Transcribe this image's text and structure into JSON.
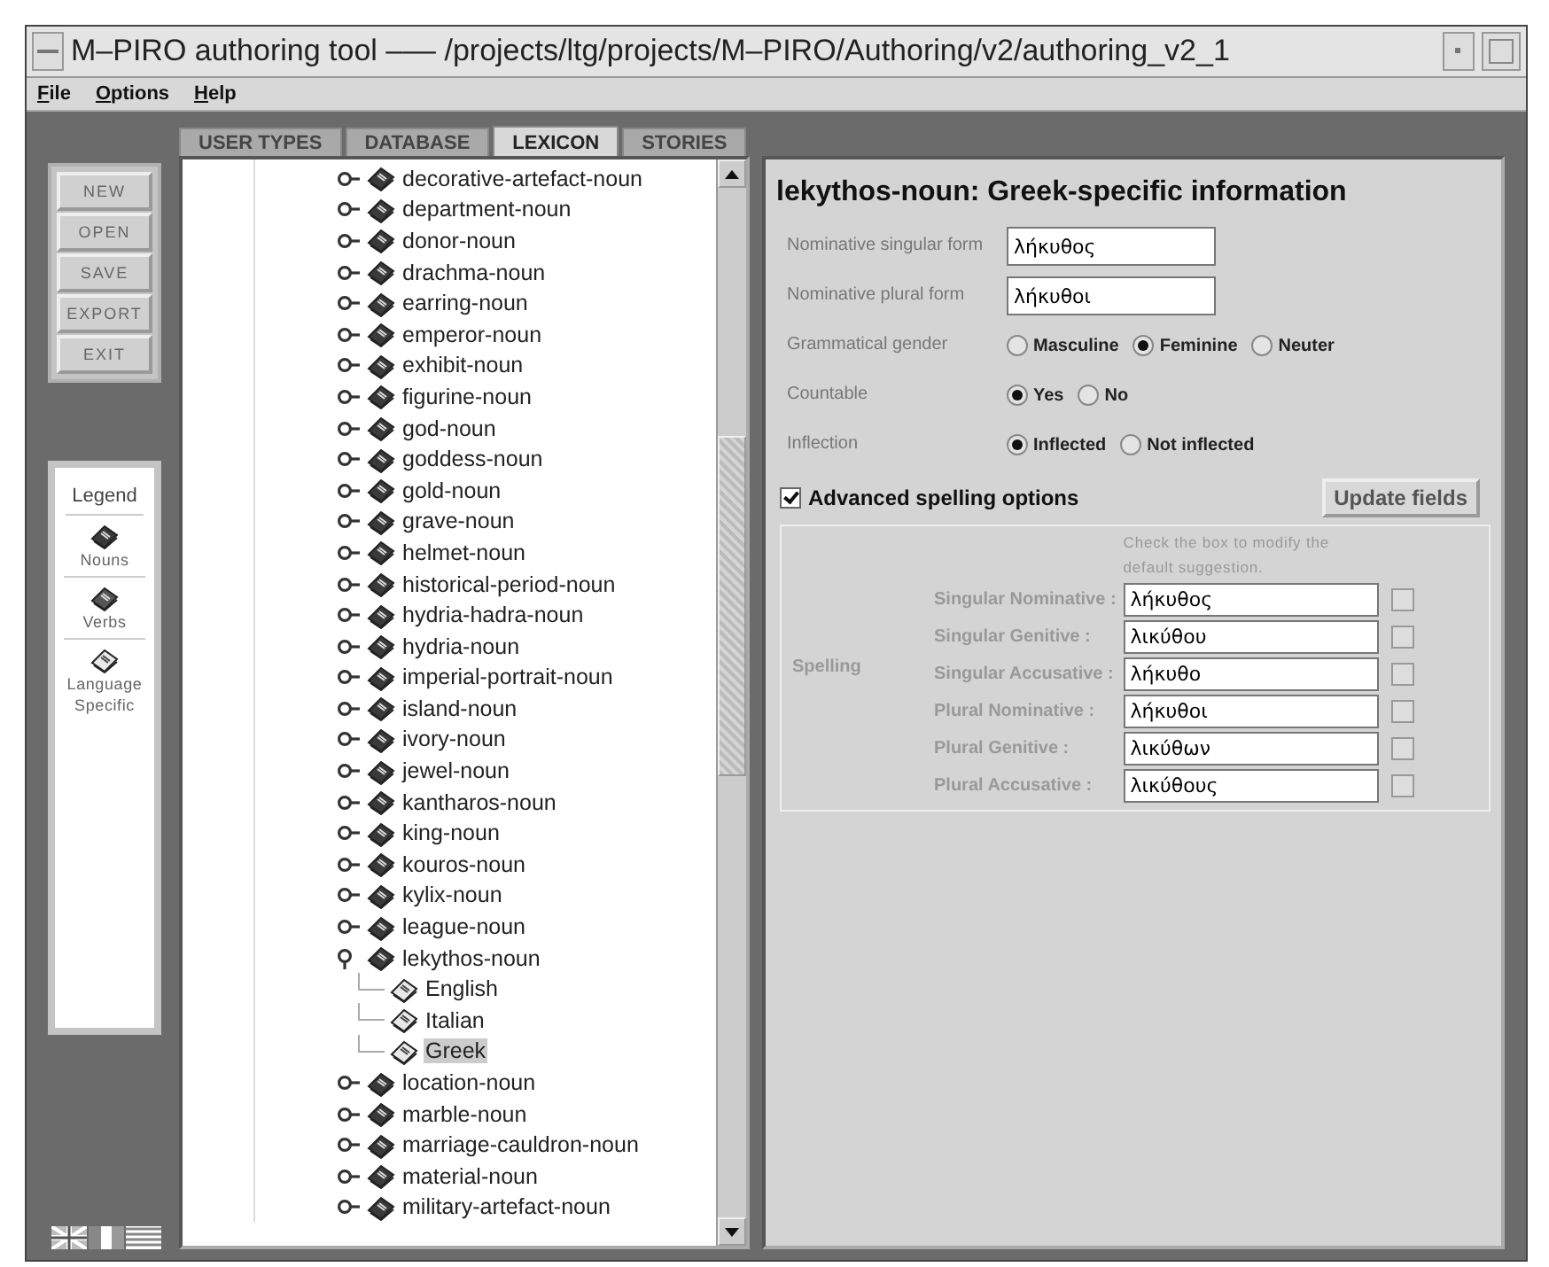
{
  "window": {
    "title": "M–PIRO authoring tool ––– /projects/ltg/projects/M–PIRO/Authoring/v2/authoring_v2_1"
  },
  "menu": [
    "File",
    "Options",
    "Help"
  ],
  "tabs": [
    {
      "label": "USER TYPES",
      "selected": false
    },
    {
      "label": "DATABASE",
      "selected": false
    },
    {
      "label": "LEXICON",
      "selected": true
    },
    {
      "label": "STORIES",
      "selected": false
    }
  ],
  "sidebar": {
    "buttons": [
      "NEW",
      "OPEN",
      "SAVE",
      "EXPORT",
      "EXIT"
    ],
    "legend": {
      "title": "Legend",
      "items": [
        {
          "kind": "noun",
          "label": "Nouns"
        },
        {
          "kind": "verb",
          "label": "Verbs"
        },
        {
          "kind": "language",
          "label": "Language Specific"
        }
      ]
    }
  },
  "tree": {
    "items": [
      {
        "label": "decorative-artefact-noun",
        "expanded": false,
        "selected": false
      },
      {
        "label": "department-noun",
        "expanded": false,
        "selected": false
      },
      {
        "label": "donor-noun",
        "expanded": false,
        "selected": false
      },
      {
        "label": "drachma-noun",
        "expanded": false,
        "selected": false
      },
      {
        "label": "earring-noun",
        "expanded": false,
        "selected": false
      },
      {
        "label": "emperor-noun",
        "expanded": false,
        "selected": false
      },
      {
        "label": "exhibit-noun",
        "expanded": false,
        "selected": false
      },
      {
        "label": "figurine-noun",
        "expanded": false,
        "selected": false
      },
      {
        "label": "god-noun",
        "expanded": false,
        "selected": false
      },
      {
        "label": "goddess-noun",
        "expanded": false,
        "selected": false
      },
      {
        "label": "gold-noun",
        "expanded": false,
        "selected": false
      },
      {
        "label": "grave-noun",
        "expanded": false,
        "selected": false
      },
      {
        "label": "helmet-noun",
        "expanded": false,
        "selected": false
      },
      {
        "label": "historical-period-noun",
        "expanded": false,
        "selected": false
      },
      {
        "label": "hydria-hadra-noun",
        "expanded": false,
        "selected": false
      },
      {
        "label": "hydria-noun",
        "expanded": false,
        "selected": false
      },
      {
        "label": "imperial-portrait-noun",
        "expanded": false,
        "selected": false
      },
      {
        "label": "island-noun",
        "expanded": false,
        "selected": false
      },
      {
        "label": "ivory-noun",
        "expanded": false,
        "selected": false
      },
      {
        "label": "jewel-noun",
        "expanded": false,
        "selected": false
      },
      {
        "label": "kantharos-noun",
        "expanded": false,
        "selected": false
      },
      {
        "label": "king-noun",
        "expanded": false,
        "selected": false
      },
      {
        "label": "kouros-noun",
        "expanded": false,
        "selected": false
      },
      {
        "label": "kylix-noun",
        "expanded": false,
        "selected": false
      },
      {
        "label": "league-noun",
        "expanded": false,
        "selected": false
      },
      {
        "label": "lekythos-noun",
        "expanded": true,
        "selected": false,
        "children": [
          {
            "label": "English",
            "selected": false
          },
          {
            "label": "Italian",
            "selected": false
          },
          {
            "label": "Greek",
            "selected": true
          }
        ]
      },
      {
        "label": "location-noun",
        "expanded": false,
        "selected": false
      },
      {
        "label": "marble-noun",
        "expanded": false,
        "selected": false
      },
      {
        "label": "marriage-cauldron-noun",
        "expanded": false,
        "selected": false
      },
      {
        "label": "material-noun",
        "expanded": false,
        "selected": false
      },
      {
        "label": "military-artefact-noun",
        "expanded": false,
        "selected": false
      }
    ]
  },
  "detail": {
    "heading": "lekythos-noun: Greek-specific information",
    "fields": [
      {
        "label": "Nominative singular form",
        "value": "λήκυθος"
      },
      {
        "label": "Nominative plural form",
        "value": "λήκυθοι"
      }
    ],
    "radio_groups": [
      {
        "label": "Grammatical gender",
        "options": [
          {
            "label": "Masculine",
            "selected": false
          },
          {
            "label": "Feminine",
            "selected": true
          },
          {
            "label": "Neuter",
            "selected": false
          }
        ]
      },
      {
        "label": "Countable",
        "options": [
          {
            "label": "Yes",
            "selected": true
          },
          {
            "label": "No",
            "selected": false
          }
        ]
      },
      {
        "label": "Inflection",
        "options": [
          {
            "label": "Inflected",
            "selected": true
          },
          {
            "label": "Not inflected",
            "selected": false
          }
        ]
      }
    ],
    "advanced": {
      "label": "Advanced spelling options",
      "checked": true
    },
    "update_button": "Update fields",
    "spelling": {
      "label": "Spelling",
      "hint": "Check the box to modify the default suggestion.",
      "rows": [
        {
          "label": "Singular Nominative :",
          "value": "λήκυθος",
          "checked": false
        },
        {
          "label": "Singular Genitive :",
          "value": "λικύθου",
          "checked": false
        },
        {
          "label": "Singular Accusative :",
          "value": "λήκυθο",
          "checked": false
        },
        {
          "label": "Plural Nominative :",
          "value": "λήκυθοι",
          "checked": false
        },
        {
          "label": "Plural Genitive :",
          "value": "λικύθων",
          "checked": false
        },
        {
          "label": "Plural Accusative :",
          "value": "λικύθους",
          "checked": false
        }
      ]
    }
  }
}
